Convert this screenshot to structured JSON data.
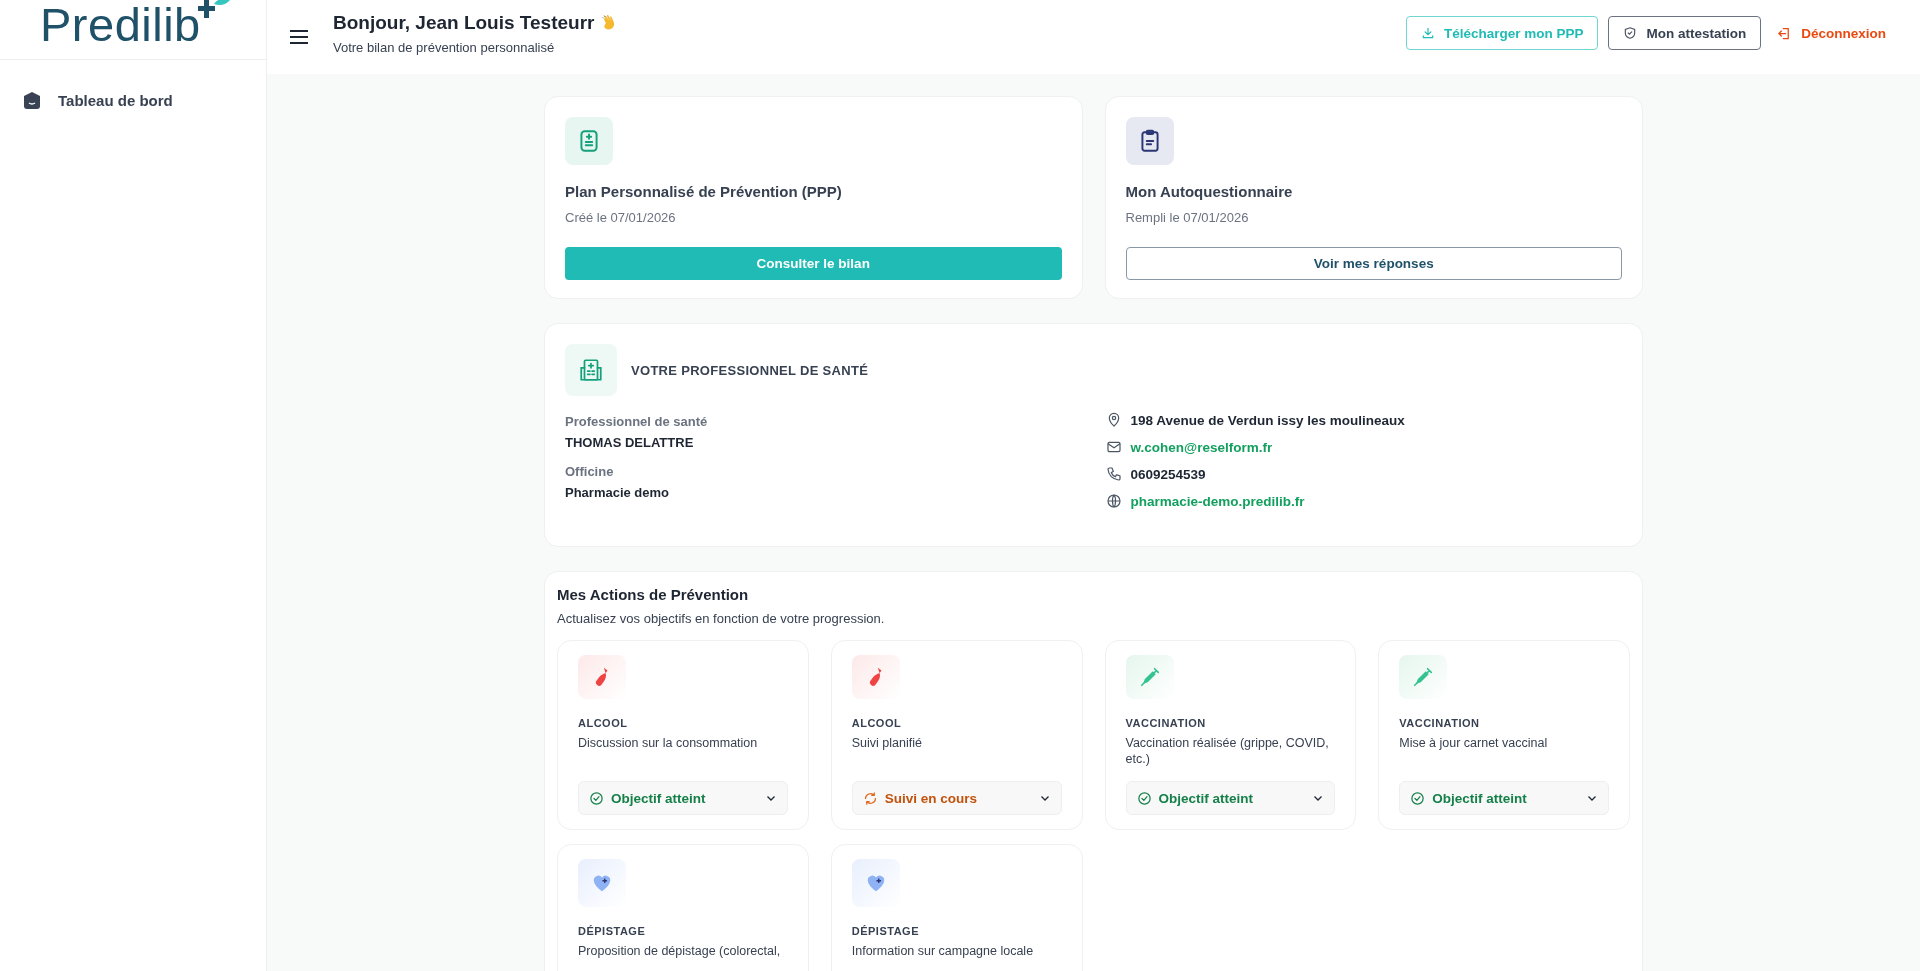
{
  "logo": {
    "text": "Predilib"
  },
  "sidebar": {
    "items": [
      {
        "label": "Tableau de bord",
        "selected": true
      }
    ]
  },
  "header": {
    "greeting": "Bonjour, Jean Louis Testeurr",
    "subtitle": "Votre bilan de prévention personnalisé",
    "buttons": [
      {
        "label": "Télécharger mon PPP",
        "kind": "download"
      },
      {
        "label": "Mon attestation",
        "kind": "attestation"
      },
      {
        "label": "Déconnexion",
        "kind": "logout"
      }
    ]
  },
  "documents": [
    {
      "kind": "plan",
      "title": "Plan Personnalisé de Prévention (PPP)",
      "date": "Créé le 07/01/2026",
      "button": "Consulter le bilan"
    },
    {
      "kind": "questionnaire",
      "title": "Mon Autoquestionnaire",
      "date": "Rempli le 07/01/2026",
      "button": "Voir mes réponses"
    }
  ],
  "professional": {
    "title": "VOTRE PROFESSIONNEL DE SANTÉ",
    "fields": [
      {
        "label": "Professionnel de santé",
        "value": "THOMAS DELATTRE"
      },
      {
        "label": "Officine",
        "value": "Pharmacie demo"
      }
    ],
    "contacts": [
      {
        "kind": "address",
        "text": "198 Avenue de Verdun issy les moulineaux"
      },
      {
        "kind": "email",
        "text": "w.cohen@reselform.fr"
      },
      {
        "kind": "phone",
        "text": "0609254539"
      },
      {
        "kind": "website",
        "text": "pharmacie-demo.predilib.fr"
      }
    ]
  },
  "actions": {
    "title": "Mes Actions de Prévention",
    "subtitle": "Actualisez vos objectifs en fonction de votre progression.",
    "items": [
      {
        "kind": "alcool",
        "category": "ALCOOL",
        "description": "Discussion sur la consommation",
        "status": {
          "kind": "achieved",
          "label": "Objectif atteint"
        }
      },
      {
        "kind": "alcool",
        "category": "ALCOOL",
        "description": "Suivi planifié",
        "status": {
          "kind": "in_progress",
          "label": "Suivi en cours"
        }
      },
      {
        "kind": "vaccination",
        "category": "VACCINATION",
        "description": "Vaccination réalisée (grippe, COVID, etc.)",
        "status": {
          "kind": "achieved",
          "label": "Objectif atteint"
        }
      },
      {
        "kind": "vaccination",
        "category": "VACCINATION",
        "description": "Mise à jour carnet vaccinal",
        "status": {
          "kind": "achieved",
          "label": "Objectif atteint"
        }
      },
      {
        "kind": "depistage",
        "category": "DÉPISTAGE",
        "description": "Proposition de dépistage (colorectal,"
      },
      {
        "kind": "depistage",
        "category": "DÉPISTAGE",
        "description": "Information sur campagne locale"
      }
    ]
  }
}
